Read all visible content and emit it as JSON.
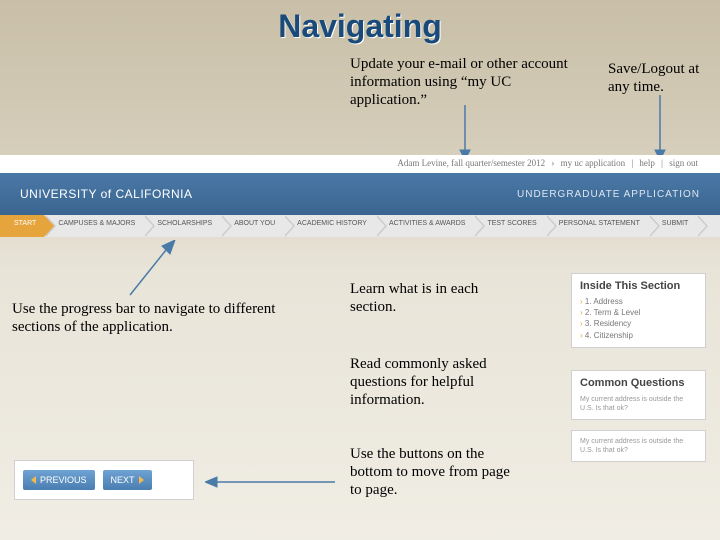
{
  "title": "Navigating",
  "annotations": {
    "update_email": "Update your e-mail or other account information using “my UC application.”",
    "save_logout": "Save/Logout at any time.",
    "progress_bar": "Use the progress bar to navigate to different sections of the application.",
    "learn_section": "Learn what is in each section.",
    "read_faq": "Read commonly asked questions for helpful information.",
    "use_buttons": "Use the buttons on the bottom to move from page to page."
  },
  "uc_header": {
    "topbar_user": "Adam Levine, fall quarter/semester 2012",
    "topbar_links": [
      "my uc application",
      "help",
      "sign out"
    ],
    "brand_line": "UNIVERSITY of CALIFORNIA",
    "app_label": "UNDERGRADUATE APPLICATION",
    "nav": [
      "START",
      "CAMPUSES & MAJORS",
      "SCHOLARSHIPS",
      "ABOUT YOU",
      "ACADEMIC HISTORY",
      "ACTIVITIES & AWARDS",
      "TEST SCORES",
      "PERSONAL STATEMENT",
      "SUBMIT"
    ]
  },
  "prevnext": {
    "prev": "PREVIOUS",
    "next": "NEXT"
  },
  "side": {
    "inside": {
      "title": "Inside This Section",
      "items": [
        "1. Address",
        "2. Term & Level",
        "3. Residency",
        "4. Citizenship"
      ]
    },
    "common": {
      "title": "Common Questions",
      "body": "My current address is outside the U.S. Is that ok?"
    },
    "common2": {
      "body": "My current address is outside the U.S. Is that ok?"
    }
  }
}
